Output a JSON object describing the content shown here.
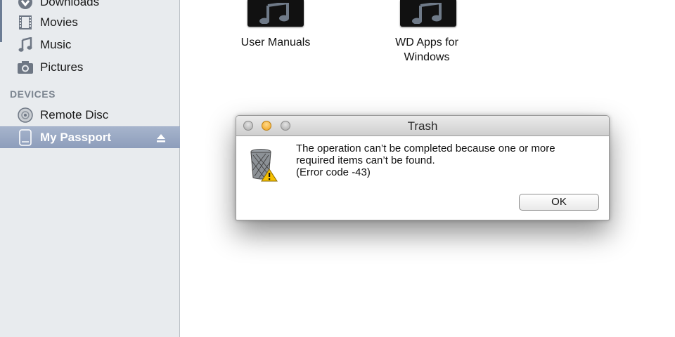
{
  "sidebar": {
    "favorites": [
      {
        "label": "Downloads",
        "icon": "downloads-icon"
      },
      {
        "label": "Movies",
        "icon": "movies-icon"
      },
      {
        "label": "Music",
        "icon": "music-icon"
      },
      {
        "label": "Pictures",
        "icon": "pictures-icon"
      }
    ],
    "devices_header": "DEVICES",
    "devices": [
      {
        "label": "Remote Disc",
        "icon": "remote-disc-icon"
      },
      {
        "label": "My Passport",
        "icon": "external-drive-icon",
        "selected": true
      }
    ]
  },
  "main": {
    "files": [
      {
        "label": "User Manuals",
        "icon": "music-folder-icon"
      },
      {
        "label_line1": "WD Apps for",
        "label_line2": "Windows",
        "icon": "music-folder-icon"
      }
    ]
  },
  "dialog": {
    "title": "Trash",
    "message_line1": "The operation can’t be completed because one or more",
    "message_line2": "required items can’t be found.",
    "message_line3": "(Error code -43)",
    "ok_label": "OK"
  },
  "colors": {
    "sidebar_bg": "#e8ebee",
    "selection": "#8d9dbb",
    "minimize_button": "#f0a21a"
  }
}
